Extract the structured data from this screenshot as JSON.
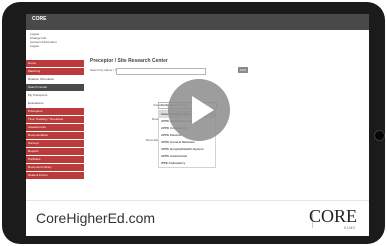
{
  "header": {
    "brand": "CORE",
    "user_menu": [
      "Logout",
      "Change Info",
      "Account Information",
      "Logout"
    ]
  },
  "sidebar": {
    "items": [
      {
        "label": "Home",
        "style": "red"
      },
      {
        "label": "Matching",
        "style": "red"
      },
      {
        "label": "Rotation Schedules",
        "style": "white"
      },
      {
        "label": "Search Center",
        "style": "active"
      },
      {
        "label": "My Preceptors",
        "style": "white"
      },
      {
        "label": "Evaluations",
        "style": "white"
      },
      {
        "label": "Preceptors",
        "style": "red"
      },
      {
        "label": "Time Tracking / Timesheet",
        "style": "red"
      },
      {
        "label": "Assessments",
        "style": "red"
      },
      {
        "label": "Documentation",
        "style": "red"
      },
      {
        "label": "Surveys",
        "style": "red"
      },
      {
        "label": "Reports",
        "style": "red"
      },
      {
        "label": "Portfolios",
        "style": "red"
      },
      {
        "label": "Document Library",
        "style": "red"
      },
      {
        "label": "Student Forms",
        "style": "red"
      }
    ]
  },
  "main": {
    "title": "Preceptor / Site Research Center",
    "search_label": "Search by Name / Site",
    "find_button": "Find",
    "labels": [
      "Rotation Type",
      "Course",
      "Rotation Dates",
      "Region",
      "Sort",
      "Show Elective Sites"
    ],
    "select_placeholder": "Select Rotation Type",
    "options": [
      "Select Rotation Type",
      "APPE Ambulatory Care",
      "APPE Community",
      "APPE Elective",
      "APPE General Medicine",
      "APPE Hospital/Health-System",
      "APPE Institutional",
      "IPPE Ambulatory"
    ]
  },
  "footer": {
    "url": "CoreHigherEd.com",
    "logo": "CORE",
    "logo_sub": "ELMS"
  },
  "colors": {
    "accent": "#b01818",
    "frame": "#1b1b1b"
  }
}
